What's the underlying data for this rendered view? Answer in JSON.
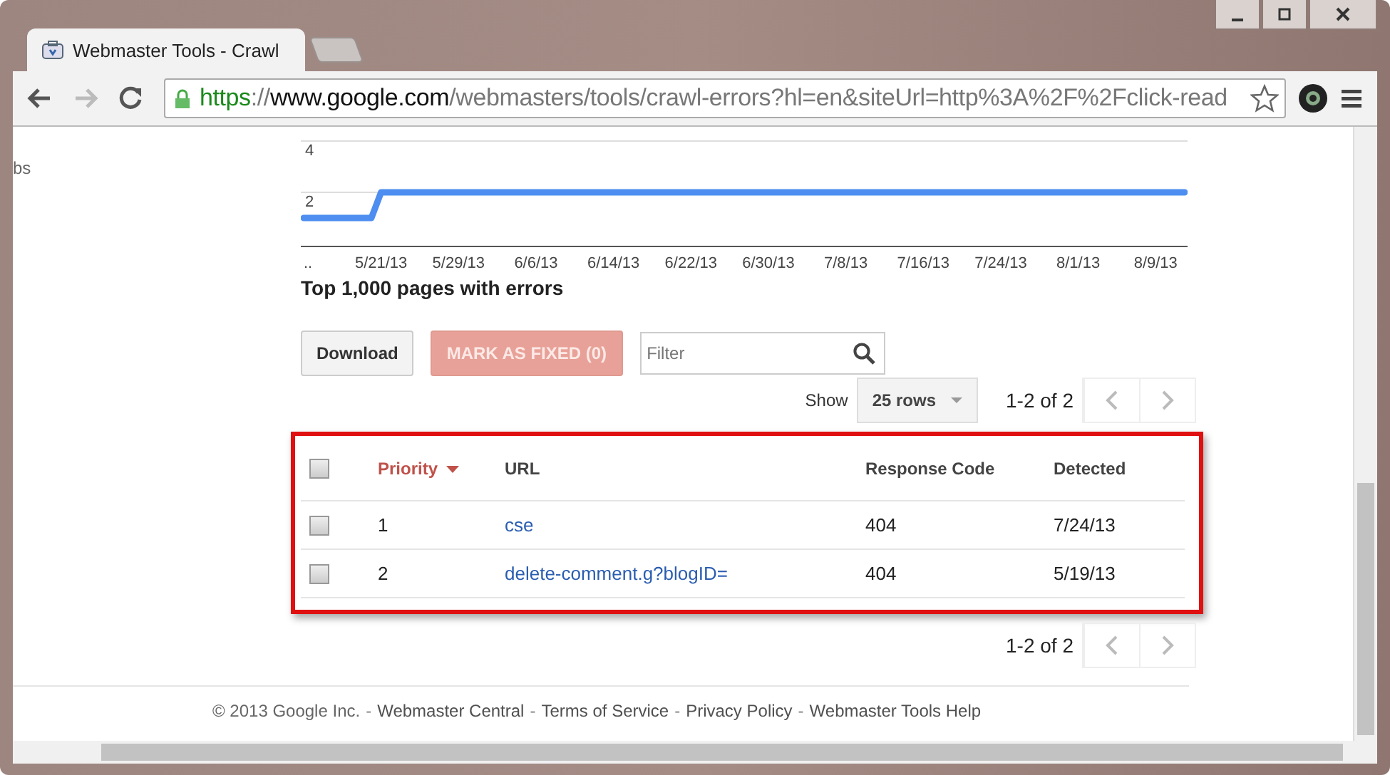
{
  "browser": {
    "tabs": [
      {
        "title": "Webmaster Tools - Crawl",
        "selected": true
      }
    ],
    "address": {
      "scheme": "https",
      "sep": "://",
      "host": "www.google.com",
      "path": "/webmasters/tools/crawl-errors?hl=en&siteUrl=http%3A%2F%2Fclick-read"
    }
  },
  "sidebar_text": "bs",
  "chart": {
    "chart_data": {
      "type": "line",
      "categories": [
        "..",
        null,
        null,
        null,
        null,
        null,
        null,
        null,
        "5/21/13",
        null,
        null,
        null,
        null,
        null,
        null,
        null,
        "5/29/13",
        null,
        null,
        null,
        null,
        null,
        null,
        null,
        "6/6/13",
        null,
        null,
        null,
        null,
        null,
        null,
        null,
        "6/14/13",
        null,
        null,
        null,
        null,
        null,
        null,
        null,
        "6/22/13",
        null,
        null,
        null,
        null,
        null,
        null,
        null,
        "6/30/13",
        null,
        null,
        null,
        null,
        null,
        null,
        null,
        "7/8/13",
        null,
        null,
        null,
        null,
        null,
        null,
        null,
        "7/16/13",
        null,
        null,
        null,
        null,
        null,
        null,
        null,
        "7/24/13",
        null,
        null,
        null,
        null,
        null,
        null,
        null,
        "8/1/13",
        null,
        null,
        null,
        null,
        null,
        null,
        null,
        "8/9/13",
        null,
        null,
        null
      ],
      "series": [
        {
          "color": "#4d8ef0",
          "values": [
            1,
            1,
            1,
            1,
            1,
            1,
            1,
            1,
            2,
            2,
            2,
            2,
            2,
            2,
            2,
            2,
            2,
            2,
            2,
            2,
            2,
            2,
            2,
            2,
            2,
            2,
            2,
            2,
            2,
            2,
            2,
            2,
            2,
            2,
            2,
            2,
            2,
            2,
            2,
            2,
            2,
            2,
            2,
            2,
            2,
            2,
            2,
            2,
            2,
            2,
            2,
            2,
            2,
            2,
            2,
            2,
            2,
            2,
            2,
            2,
            2,
            2,
            2,
            2,
            2,
            2,
            2,
            2,
            2,
            2,
            2,
            2,
            2,
            2,
            2,
            2,
            2,
            2,
            2,
            2,
            2,
            2,
            2,
            2,
            2,
            2,
            2,
            2,
            2,
            2,
            2,
            2
          ]
        }
      ],
      "ylim": [
        0,
        4
      ],
      "yticks": [
        2,
        4
      ]
    }
  },
  "heading": "Top 1,000 pages with errors",
  "toolbar": {
    "download": "Download",
    "mark_fixed": {
      "label": "MARK AS FIXED (0)",
      "disabled": true
    },
    "filter": {
      "placeholder": "Filter"
    }
  },
  "pager_top": {
    "show_label": "Show",
    "rows": "25 rows",
    "range": "1-2 of 2"
  },
  "table": {
    "all_checked": false,
    "columns": [
      {
        "label": "Priority",
        "sorted": true
      },
      {
        "label": "URL",
        "sorted": false
      },
      {
        "label": "Response Code",
        "sorted": false
      },
      {
        "label": "Detected",
        "sorted": false
      }
    ],
    "rows": [
      {
        "checked": false,
        "priority": "1",
        "url": "cse",
        "code": "404",
        "detected": "7/24/13"
      },
      {
        "checked": false,
        "priority": "2",
        "url": "delete-comment.g?blogID=",
        "code": "404",
        "detected": "5/19/13"
      }
    ]
  },
  "pager_bottom": {
    "range": "1-2 of 2"
  },
  "footer": [
    {
      "kind": "text",
      "text": "© 2013 Google Inc."
    },
    {
      "kind": "sep",
      "text": "-"
    },
    {
      "kind": "link",
      "text": "Webmaster Central"
    },
    {
      "kind": "sep",
      "text": "-"
    },
    {
      "kind": "link",
      "text": "Terms of Service"
    },
    {
      "kind": "sep",
      "text": "-"
    },
    {
      "kind": "link",
      "text": "Privacy Policy"
    },
    {
      "kind": "sep",
      "text": "-"
    },
    {
      "kind": "link",
      "text": "Webmaster Tools Help"
    }
  ]
}
